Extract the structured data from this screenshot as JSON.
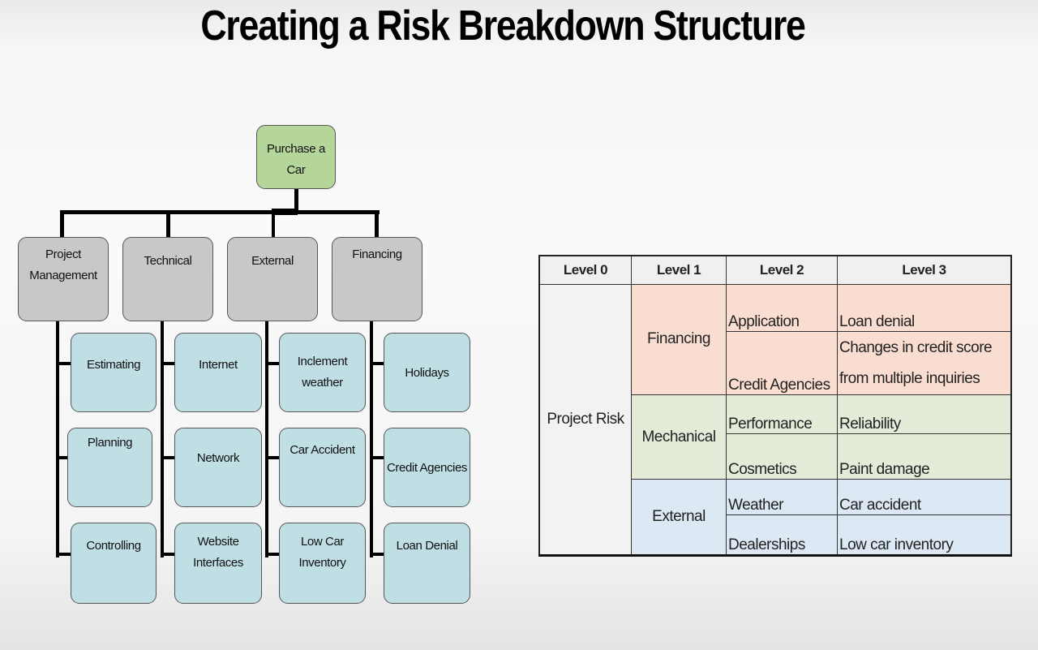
{
  "title": "Creating a Risk Breakdown Structure",
  "diagram": {
    "root": "Purchase a Car",
    "categories": [
      {
        "label_lines": [
          "Project",
          "Management"
        ],
        "children": [
          [
            "Estimating"
          ],
          [
            "Planning"
          ],
          [
            "Controlling"
          ]
        ]
      },
      {
        "label_lines": [
          "Technical"
        ],
        "children": [
          [
            "Internet"
          ],
          [
            "Network"
          ],
          [
            "Website",
            "Interfaces"
          ]
        ]
      },
      {
        "label_lines": [
          "External"
        ],
        "children": [
          [
            "Inclement",
            "weather"
          ],
          [
            "Car Accident"
          ],
          [
            "Low Car",
            "Inventory"
          ]
        ]
      },
      {
        "label_lines": [
          "Financing"
        ],
        "children": [
          [
            "Holidays"
          ],
          [
            "Credit Agencies"
          ],
          [
            "Loan Denial"
          ]
        ]
      }
    ],
    "colors": {
      "root": "#b5d69a",
      "category": "#c8c8c8",
      "leaf": "#bfdfe5"
    }
  },
  "table": {
    "headers": [
      "Level 0",
      "Level 1",
      "Level 2",
      "Level 3"
    ],
    "level0": "Project Risk",
    "groups": [
      {
        "level1": "Financing",
        "color": "#f9ddd0",
        "rows": [
          {
            "level2": "Application",
            "level3": "Loan denial"
          },
          {
            "level2": "Credit Agencies",
            "level3": "Changes in credit score from multiple inquiries"
          }
        ]
      },
      {
        "level1": "Mechanical",
        "color": "#e2ecd8",
        "rows": [
          {
            "level2": "Performance",
            "level3": "Reliability"
          },
          {
            "level2": "Cosmetics",
            "level3": "Paint damage"
          }
        ]
      },
      {
        "level1": "External",
        "color": "#dce8f3",
        "rows": [
          {
            "level2": "Weather",
            "level3": "Car accident"
          },
          {
            "level2": "Dealerships",
            "level3": "Low car inventory"
          }
        ]
      }
    ]
  }
}
